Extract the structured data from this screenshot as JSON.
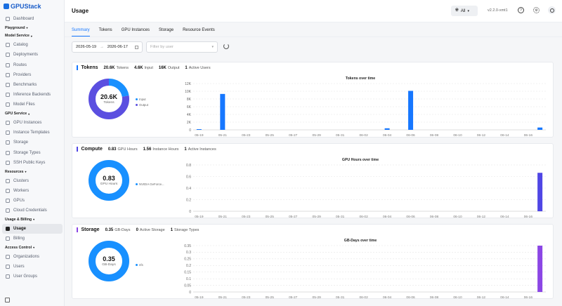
{
  "app": {
    "name": "GPUStack",
    "version": "v2.2.0-xmt1"
  },
  "sidebar": {
    "groups": [
      {
        "type": "item",
        "label": "Dashboard",
        "icon": "dashboard-icon"
      },
      {
        "type": "section",
        "label": "Playground"
      },
      {
        "type": "section",
        "label": "Model Service"
      },
      {
        "type": "item",
        "label": "Catalog",
        "icon": "catalog-icon"
      },
      {
        "type": "item",
        "label": "Deployments",
        "icon": "deployments-icon"
      },
      {
        "type": "item",
        "label": "Routes",
        "icon": "routes-icon"
      },
      {
        "type": "item",
        "label": "Providers",
        "icon": "providers-icon"
      },
      {
        "type": "item",
        "label": "Benchmarks",
        "icon": "benchmarks-icon"
      },
      {
        "type": "item",
        "label": "Inference Backends",
        "icon": "backends-icon"
      },
      {
        "type": "item",
        "label": "Model Files",
        "icon": "model-files-icon"
      },
      {
        "type": "section",
        "label": "GPU Service"
      },
      {
        "type": "item",
        "label": "GPU Instances",
        "icon": "gpu-instances-icon"
      },
      {
        "type": "item",
        "label": "Instance Templates",
        "icon": "templates-icon"
      },
      {
        "type": "item",
        "label": "Storage",
        "icon": "storage-icon"
      },
      {
        "type": "item",
        "label": "Storage Types",
        "icon": "storage-types-icon"
      },
      {
        "type": "item",
        "label": "SSH Public Keys",
        "icon": "key-icon"
      },
      {
        "type": "section",
        "label": "Resources"
      },
      {
        "type": "item",
        "label": "Clusters",
        "icon": "clusters-icon"
      },
      {
        "type": "item",
        "label": "Workers",
        "icon": "workers-icon"
      },
      {
        "type": "item",
        "label": "GPUs",
        "icon": "gpus-icon"
      },
      {
        "type": "item",
        "label": "Cloud Credentials",
        "icon": "credentials-icon"
      },
      {
        "type": "section",
        "label": "Usage & Billing"
      },
      {
        "type": "item",
        "label": "Usage",
        "icon": "usage-icon",
        "active": true
      },
      {
        "type": "item",
        "label": "Billing",
        "icon": "billing-icon"
      },
      {
        "type": "section",
        "label": "Access Control"
      },
      {
        "type": "item",
        "label": "Organizations",
        "icon": "organizations-icon"
      },
      {
        "type": "item",
        "label": "Users",
        "icon": "users-icon"
      },
      {
        "type": "item",
        "label": "User Groups",
        "icon": "user-groups-icon"
      }
    ]
  },
  "header": {
    "title": "Usage",
    "language": "All"
  },
  "tabs": [
    "Summary",
    "Tokens",
    "GPU Instances",
    "Storage",
    "Resource Events"
  ],
  "active_tab": "Summary",
  "filters": {
    "start_date": "2026-05-19",
    "end_date": "2026-06-17",
    "user_placeholder": "Filter by user"
  },
  "colors": {
    "input": "#1890ff",
    "output": "#5b4fe0",
    "gpu": "#4b3fd6",
    "storage": "#9b4fe0",
    "tokens_bar": "#1677ff",
    "compute_bar": "#4f46e5",
    "storage_bar": "#8b46e5"
  },
  "cards": {
    "tokens": {
      "title": "Tokens",
      "stats": [
        {
          "value": "20.6K",
          "label": "Tokens"
        },
        {
          "value": "4.6K",
          "label": "Input"
        },
        {
          "value": "16K",
          "label": "Output"
        },
        {
          "value": "1",
          "label": "Active Users"
        }
      ],
      "donut_value": "20.6K",
      "donut_label": "Tokens",
      "legend": [
        "Input",
        "Output"
      ]
    },
    "compute": {
      "title": "Compute",
      "stats": [
        {
          "value": "0.83",
          "label": "GPU Hours"
        },
        {
          "value": "1.56",
          "label": "Instance Hours"
        },
        {
          "value": "1",
          "label": "Active Instances"
        }
      ],
      "donut_value": "0.83",
      "donut_label": "GPU Hours",
      "legend": [
        "NVIDIA GeForce..."
      ]
    },
    "storage": {
      "title": "Storage",
      "stats": [
        {
          "value": "0.35",
          "label": "GB-Days"
        },
        {
          "value": "0",
          "label": "Active Storage"
        },
        {
          "value": "1",
          "label": "Storage Types"
        }
      ],
      "donut_value": "0.35",
      "donut_label": "GB-Days",
      "legend": [
        "nfs"
      ]
    }
  },
  "chart_data": [
    {
      "type": "bar",
      "title": "Tokens over time",
      "x": [
        "05-19",
        "05-20",
        "05-21",
        "05-22",
        "05-23",
        "05-24",
        "05-25",
        "05-26",
        "05-27",
        "05-28",
        "05-29",
        "05-30",
        "05-31",
        "06-01",
        "06-02",
        "06-03",
        "06-04",
        "06-05",
        "06-06",
        "06-07",
        "06-08",
        "06-09",
        "06-10",
        "06-11",
        "06-12",
        "06-13",
        "06-14",
        "06-15",
        "06-16",
        "06-17"
      ],
      "x_tick_labels": [
        "05-19",
        "05-21",
        "05-23",
        "05-25",
        "05-27",
        "05-29",
        "05-31",
        "06-02",
        "06-04",
        "06-06",
        "06-08",
        "06-10",
        "06-12",
        "06-14",
        "06-16"
      ],
      "values": [
        180,
        0,
        9300,
        0,
        0,
        0,
        0,
        0,
        0,
        0,
        0,
        0,
        0,
        0,
        0,
        0,
        400,
        0,
        10100,
        0,
        0,
        0,
        0,
        0,
        0,
        0,
        0,
        0,
        0,
        600
      ],
      "y_ticks": [
        "0",
        "2K",
        "4K",
        "6K",
        "8K",
        "10K",
        "12K"
      ],
      "ylim": [
        0,
        12000
      ]
    },
    {
      "type": "bar",
      "title": "GPU Hours over time",
      "x": [
        "05-19",
        "05-20",
        "05-21",
        "05-22",
        "05-23",
        "05-24",
        "05-25",
        "05-26",
        "05-27",
        "05-28",
        "05-29",
        "05-30",
        "05-31",
        "06-01",
        "06-02",
        "06-03",
        "06-04",
        "06-05",
        "06-06",
        "06-07",
        "06-08",
        "06-09",
        "06-10",
        "06-11",
        "06-12",
        "06-13",
        "06-14",
        "06-15",
        "06-16",
        "06-17"
      ],
      "x_tick_labels": [
        "05-19",
        "05-21",
        "05-23",
        "05-25",
        "05-27",
        "05-29",
        "05-31",
        "06-02",
        "06-04",
        "06-06",
        "06-08",
        "06-10",
        "06-12",
        "06-14",
        "06-16"
      ],
      "values": [
        0,
        0,
        0,
        0,
        0,
        0,
        0,
        0,
        0,
        0,
        0,
        0,
        0,
        0,
        0,
        0,
        0,
        0,
        0,
        0,
        0,
        0,
        0,
        0,
        0,
        0,
        0,
        0,
        0,
        0.83
      ],
      "y_ticks": [
        "0",
        "0.2",
        "0.4",
        "0.6",
        "0.8"
      ],
      "ylim": [
        0,
        1
      ]
    },
    {
      "type": "bar",
      "title": "GB-Days over time",
      "x": [
        "05-19",
        "05-20",
        "05-21",
        "05-22",
        "05-23",
        "05-24",
        "05-25",
        "05-26",
        "05-27",
        "05-28",
        "05-29",
        "05-30",
        "05-31",
        "06-01",
        "06-02",
        "06-03",
        "06-04",
        "06-05",
        "06-06",
        "06-07",
        "06-08",
        "06-09",
        "06-10",
        "06-11",
        "06-12",
        "06-13",
        "06-14",
        "06-15",
        "06-16",
        "06-17"
      ],
      "x_tick_labels": [
        "05-19",
        "05-21",
        "05-23",
        "05-25",
        "05-27",
        "05-29",
        "05-31",
        "06-02",
        "06-04",
        "06-06",
        "06-08",
        "06-10",
        "06-12",
        "06-14",
        "06-16"
      ],
      "values": [
        0,
        0,
        0,
        0,
        0,
        0,
        0,
        0,
        0,
        0,
        0,
        0,
        0,
        0,
        0,
        0,
        0,
        0,
        0,
        0,
        0,
        0,
        0,
        0,
        0,
        0,
        0,
        0,
        0,
        0.35
      ],
      "y_ticks": [
        "0",
        "0.05",
        "0.1",
        "0.15",
        "0.2",
        "0.25",
        "0.3",
        "0.35"
      ],
      "ylim": [
        0,
        0.35
      ]
    }
  ]
}
